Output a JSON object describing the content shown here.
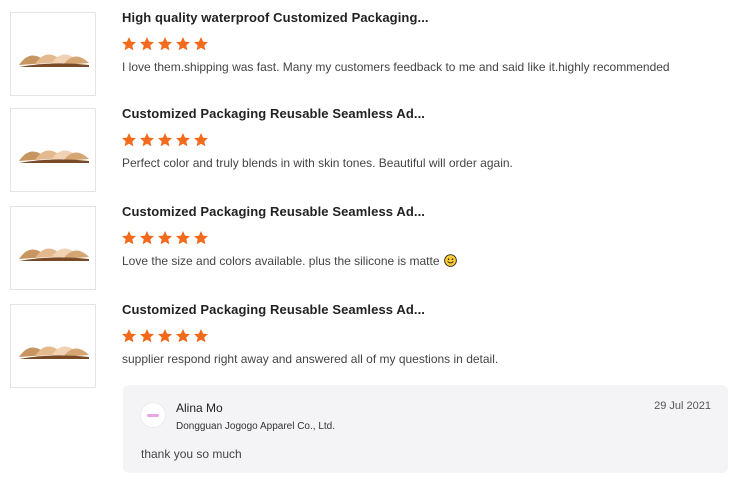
{
  "reviews": [
    {
      "title": "High quality waterproof Customized Packaging...",
      "rating": 5,
      "comment": "I love them.shipping was fast. Many my customers feedback to me and said like it.highly recommended",
      "has_emoji": false
    },
    {
      "title": "Customized Packaging Reusable Seamless Ad...",
      "rating": 5,
      "comment": "Perfect color and truly blends in with skin tones. Beautiful will order again.",
      "has_emoji": false
    },
    {
      "title": "Customized Packaging Reusable Seamless Ad...",
      "rating": 5,
      "comment": "Love the size and colors available. plus the silicone is matte",
      "has_emoji": true
    },
    {
      "title": "Customized Packaging Reusable Seamless Ad...",
      "rating": 5,
      "comment": "supplier respond right away and answered all of my questions in detail.",
      "has_emoji": false
    }
  ],
  "reply": {
    "name": "Alina Mo",
    "company": "Dongguan Jogogo Apparel Co., Ltd.",
    "date": "29 Jul 2021",
    "text": "thank you so much"
  },
  "colors": {
    "star": "#f26a1b",
    "reply_bg": "#f4f4f6",
    "thumb_border": "#e3e3e3"
  },
  "icons": {
    "star": "star-icon",
    "emoji": "smiley-emoji-icon",
    "product": "nipple-cover-product-image"
  }
}
